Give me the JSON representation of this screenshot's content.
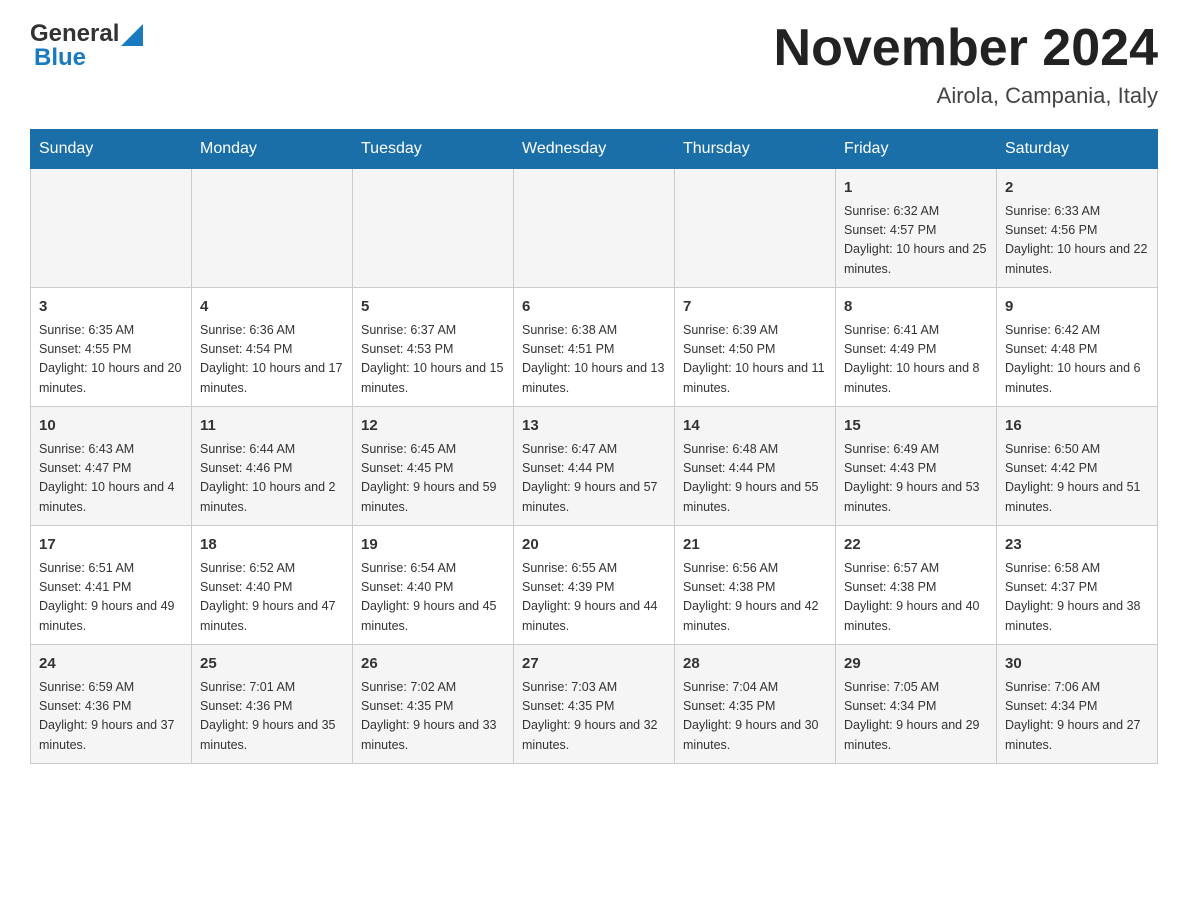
{
  "header": {
    "logo": {
      "general": "General",
      "blue": "Blue"
    },
    "title": "November 2024",
    "location": "Airola, Campania, Italy"
  },
  "weekdays": [
    "Sunday",
    "Monday",
    "Tuesday",
    "Wednesday",
    "Thursday",
    "Friday",
    "Saturday"
  ],
  "weeks": [
    [
      {
        "day": "",
        "info": ""
      },
      {
        "day": "",
        "info": ""
      },
      {
        "day": "",
        "info": ""
      },
      {
        "day": "",
        "info": ""
      },
      {
        "day": "",
        "info": ""
      },
      {
        "day": "1",
        "info": "Sunrise: 6:32 AM\nSunset: 4:57 PM\nDaylight: 10 hours and 25 minutes."
      },
      {
        "day": "2",
        "info": "Sunrise: 6:33 AM\nSunset: 4:56 PM\nDaylight: 10 hours and 22 minutes."
      }
    ],
    [
      {
        "day": "3",
        "info": "Sunrise: 6:35 AM\nSunset: 4:55 PM\nDaylight: 10 hours and 20 minutes."
      },
      {
        "day": "4",
        "info": "Sunrise: 6:36 AM\nSunset: 4:54 PM\nDaylight: 10 hours and 17 minutes."
      },
      {
        "day": "5",
        "info": "Sunrise: 6:37 AM\nSunset: 4:53 PM\nDaylight: 10 hours and 15 minutes."
      },
      {
        "day": "6",
        "info": "Sunrise: 6:38 AM\nSunset: 4:51 PM\nDaylight: 10 hours and 13 minutes."
      },
      {
        "day": "7",
        "info": "Sunrise: 6:39 AM\nSunset: 4:50 PM\nDaylight: 10 hours and 11 minutes."
      },
      {
        "day": "8",
        "info": "Sunrise: 6:41 AM\nSunset: 4:49 PM\nDaylight: 10 hours and 8 minutes."
      },
      {
        "day": "9",
        "info": "Sunrise: 6:42 AM\nSunset: 4:48 PM\nDaylight: 10 hours and 6 minutes."
      }
    ],
    [
      {
        "day": "10",
        "info": "Sunrise: 6:43 AM\nSunset: 4:47 PM\nDaylight: 10 hours and 4 minutes."
      },
      {
        "day": "11",
        "info": "Sunrise: 6:44 AM\nSunset: 4:46 PM\nDaylight: 10 hours and 2 minutes."
      },
      {
        "day": "12",
        "info": "Sunrise: 6:45 AM\nSunset: 4:45 PM\nDaylight: 9 hours and 59 minutes."
      },
      {
        "day": "13",
        "info": "Sunrise: 6:47 AM\nSunset: 4:44 PM\nDaylight: 9 hours and 57 minutes."
      },
      {
        "day": "14",
        "info": "Sunrise: 6:48 AM\nSunset: 4:44 PM\nDaylight: 9 hours and 55 minutes."
      },
      {
        "day": "15",
        "info": "Sunrise: 6:49 AM\nSunset: 4:43 PM\nDaylight: 9 hours and 53 minutes."
      },
      {
        "day": "16",
        "info": "Sunrise: 6:50 AM\nSunset: 4:42 PM\nDaylight: 9 hours and 51 minutes."
      }
    ],
    [
      {
        "day": "17",
        "info": "Sunrise: 6:51 AM\nSunset: 4:41 PM\nDaylight: 9 hours and 49 minutes."
      },
      {
        "day": "18",
        "info": "Sunrise: 6:52 AM\nSunset: 4:40 PM\nDaylight: 9 hours and 47 minutes."
      },
      {
        "day": "19",
        "info": "Sunrise: 6:54 AM\nSunset: 4:40 PM\nDaylight: 9 hours and 45 minutes."
      },
      {
        "day": "20",
        "info": "Sunrise: 6:55 AM\nSunset: 4:39 PM\nDaylight: 9 hours and 44 minutes."
      },
      {
        "day": "21",
        "info": "Sunrise: 6:56 AM\nSunset: 4:38 PM\nDaylight: 9 hours and 42 minutes."
      },
      {
        "day": "22",
        "info": "Sunrise: 6:57 AM\nSunset: 4:38 PM\nDaylight: 9 hours and 40 minutes."
      },
      {
        "day": "23",
        "info": "Sunrise: 6:58 AM\nSunset: 4:37 PM\nDaylight: 9 hours and 38 minutes."
      }
    ],
    [
      {
        "day": "24",
        "info": "Sunrise: 6:59 AM\nSunset: 4:36 PM\nDaylight: 9 hours and 37 minutes."
      },
      {
        "day": "25",
        "info": "Sunrise: 7:01 AM\nSunset: 4:36 PM\nDaylight: 9 hours and 35 minutes."
      },
      {
        "day": "26",
        "info": "Sunrise: 7:02 AM\nSunset: 4:35 PM\nDaylight: 9 hours and 33 minutes."
      },
      {
        "day": "27",
        "info": "Sunrise: 7:03 AM\nSunset: 4:35 PM\nDaylight: 9 hours and 32 minutes."
      },
      {
        "day": "28",
        "info": "Sunrise: 7:04 AM\nSunset: 4:35 PM\nDaylight: 9 hours and 30 minutes."
      },
      {
        "day": "29",
        "info": "Sunrise: 7:05 AM\nSunset: 4:34 PM\nDaylight: 9 hours and 29 minutes."
      },
      {
        "day": "30",
        "info": "Sunrise: 7:06 AM\nSunset: 4:34 PM\nDaylight: 9 hours and 27 minutes."
      }
    ]
  ]
}
